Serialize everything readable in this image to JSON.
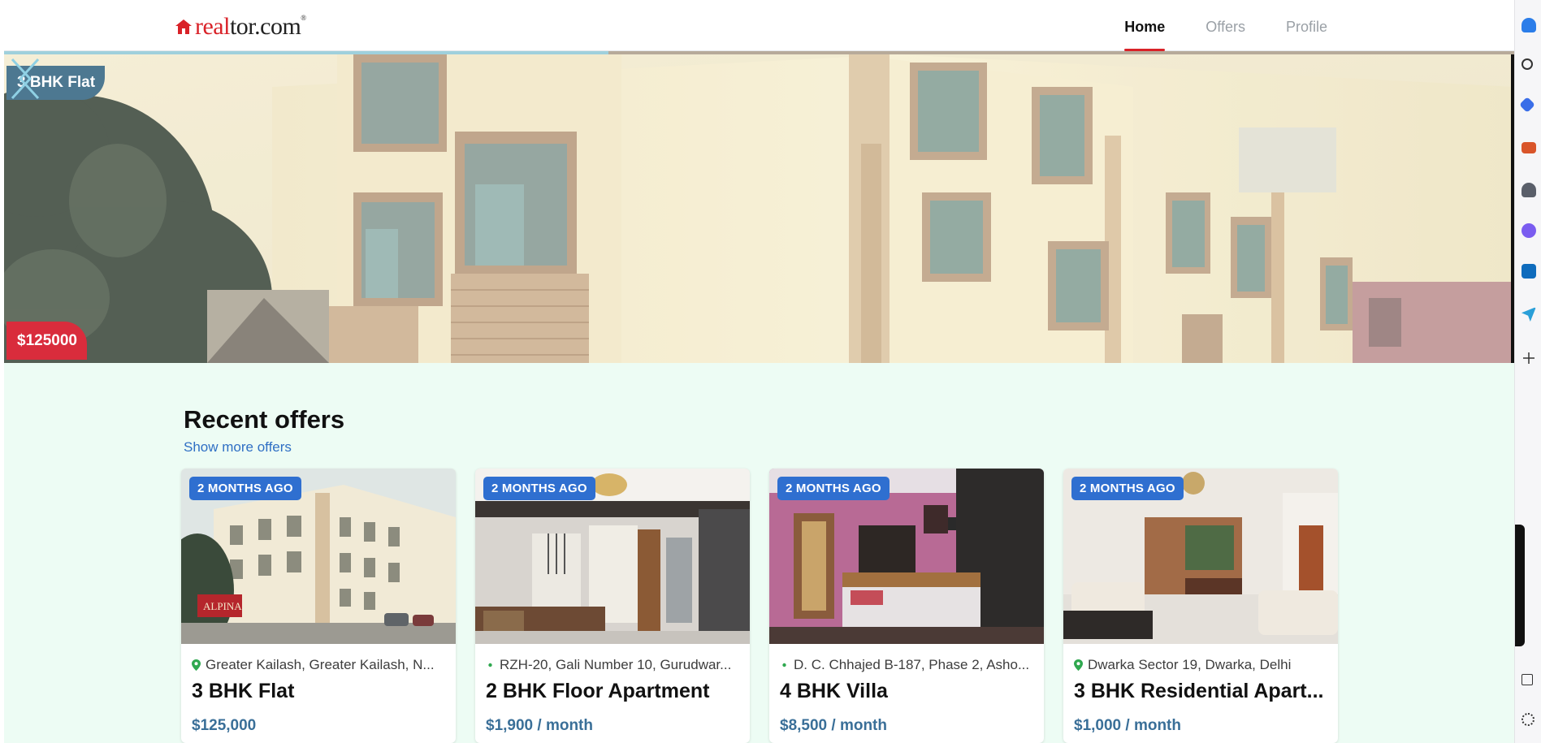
{
  "header": {
    "logo_text_red": "real",
    "logo_text_dark": "tor.com",
    "logo_mark": "®",
    "nav": [
      {
        "label": "Home",
        "active": true
      },
      {
        "label": "Offers",
        "active": false
      },
      {
        "label": "Profile",
        "active": false
      }
    ]
  },
  "hero": {
    "tag": "3 BHK Flat",
    "price": "$125000",
    "slide_progress": 0.4,
    "prev_icon": "chevron-left-icon",
    "next_icon": "chevron-right-icon"
  },
  "offers": {
    "title": "Recent offers",
    "show_more": "Show more offers",
    "cards": [
      {
        "badge": "2 MONTHS AGO",
        "location": "Greater Kailash, Greater Kailash, N...",
        "title": "3 BHK Flat",
        "price": "$125,000"
      },
      {
        "badge": "2 MONTHS AGO",
        "location": "RZH-20, Gali Number 10, Gurudwar...",
        "title": "2 BHK Floor Apartment",
        "price": "$1,900 / month"
      },
      {
        "badge": "2 MONTHS AGO",
        "location": "D. C. Chhajed B-187, Phase 2, Asho...",
        "title": "4 BHK Villa",
        "price": "$8,500 / month"
      },
      {
        "badge": "2 MONTHS AGO",
        "location": "Dwarka Sector 19, Dwarka, Delhi",
        "title": "3 BHK Residential Apart...",
        "price": "$1,000 / month"
      }
    ]
  },
  "colors": {
    "brand_red": "#d92228",
    "badge_blue": "#2f6fd0",
    "price_blue": "#3a6f98",
    "offers_bg": "#edfcf4",
    "hero_tag_bg": "#4d7891",
    "hero_price_bg": "#d92c3c"
  },
  "side_rail_icons": [
    "bell-icon",
    "search-icon",
    "diamond-icon",
    "briefcase-icon",
    "person-icon",
    "copilot-icon",
    "outlook-icon",
    "send-icon",
    "plus-icon",
    "window-icon",
    "gear-icon"
  ]
}
